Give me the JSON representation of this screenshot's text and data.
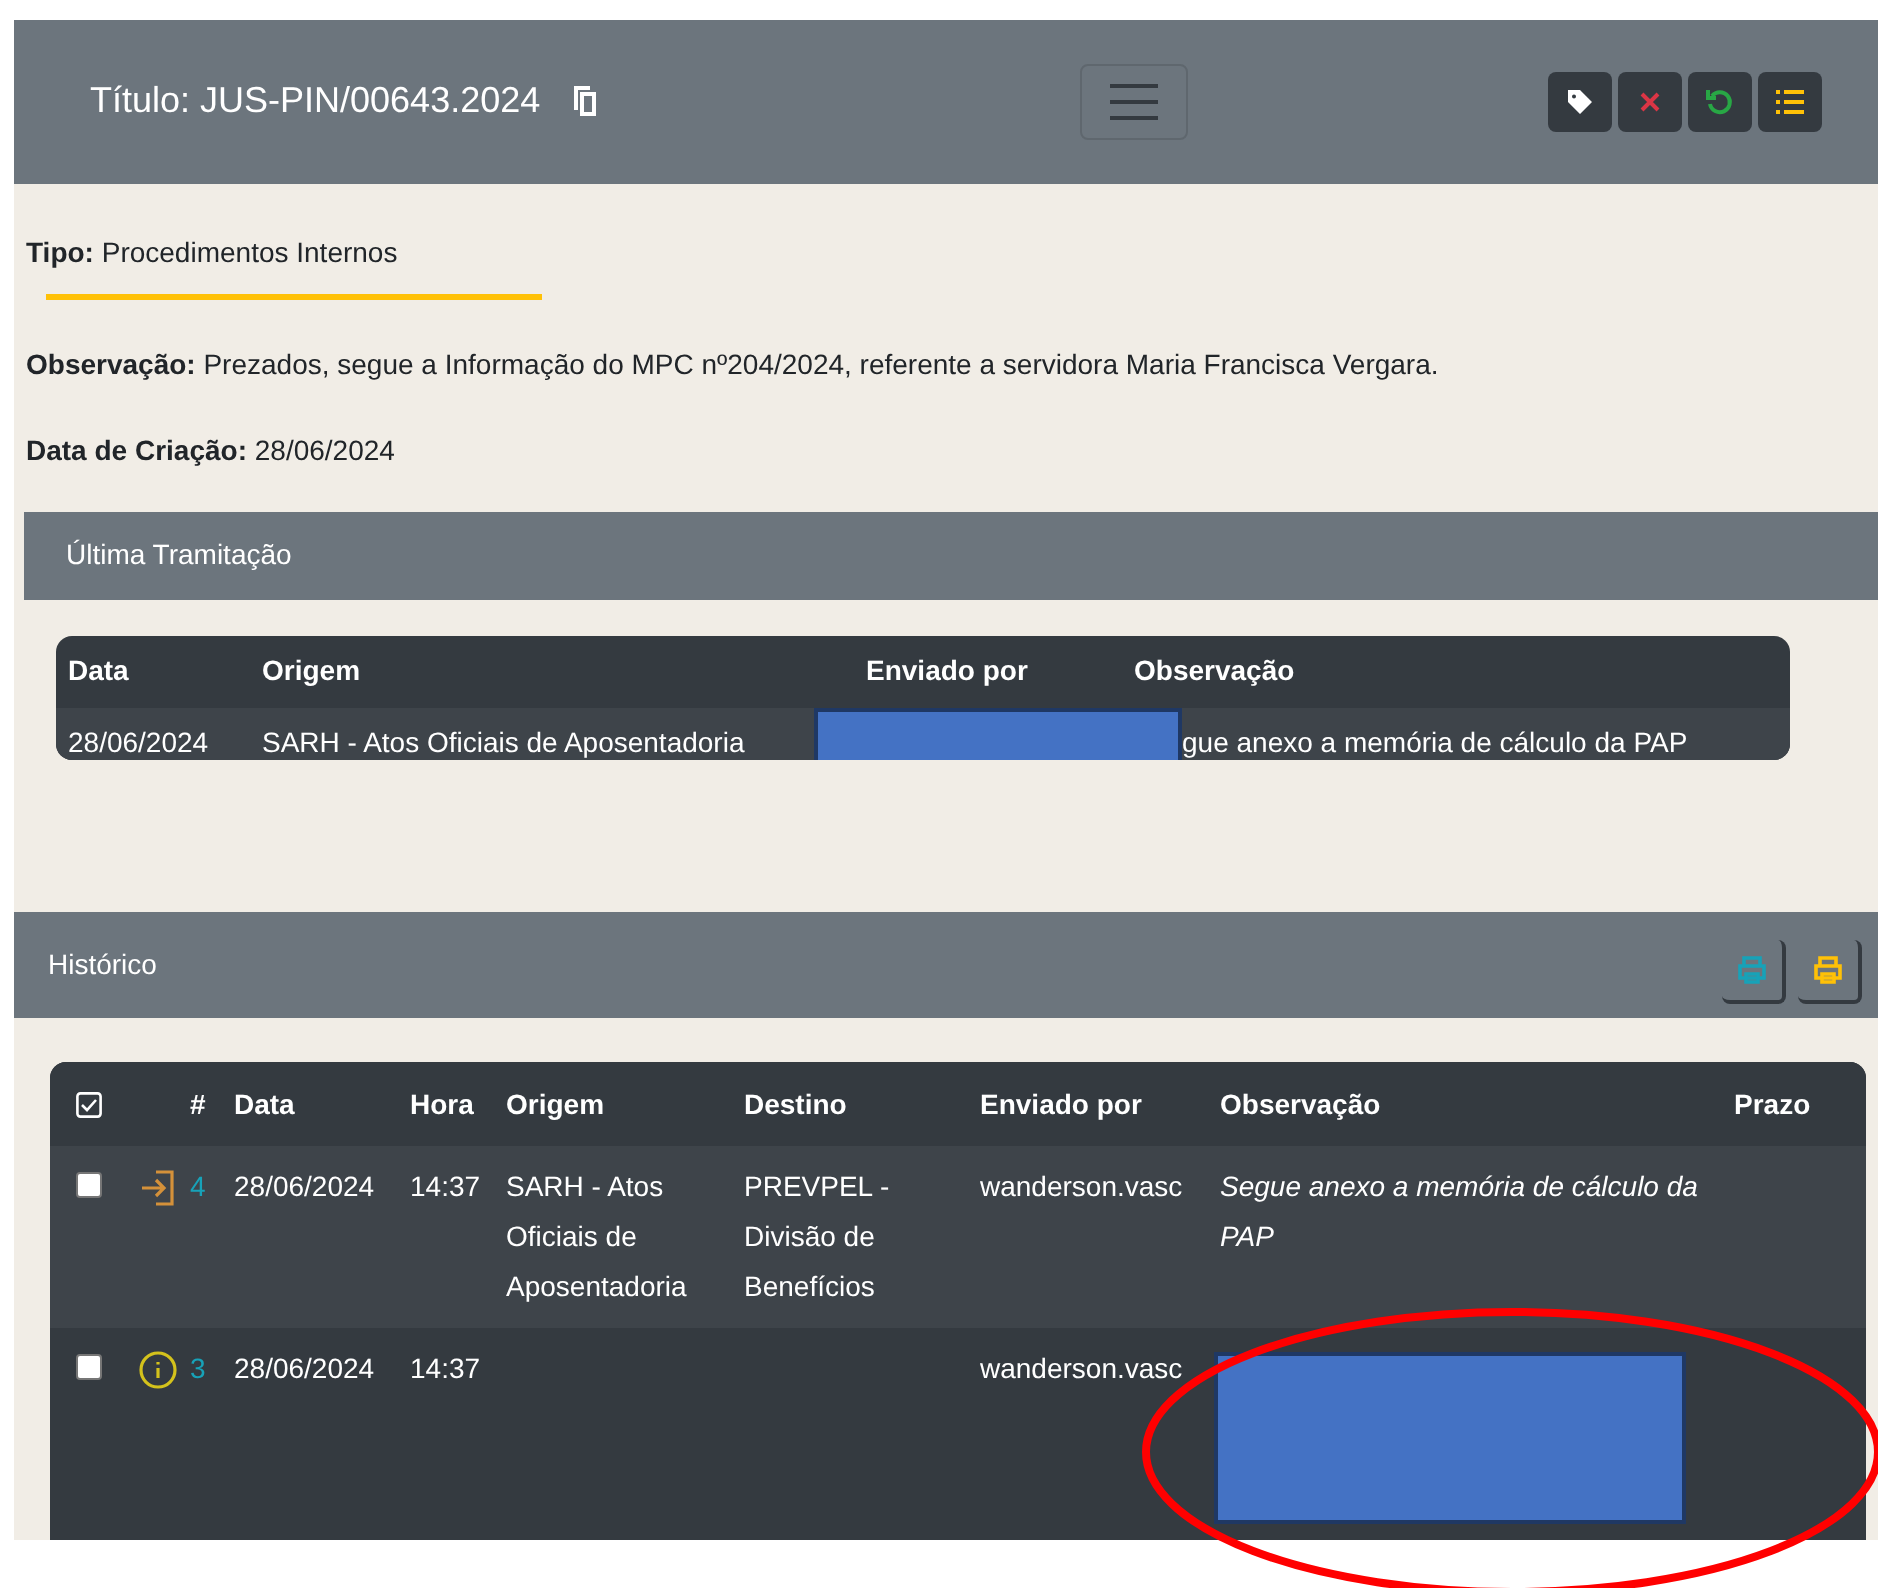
{
  "header": {
    "title": "Título: JUS-PIN/00643.2024"
  },
  "details": [
    {
      "label": "Tipo:",
      "value": "Procedimentos Internos",
      "underline": true
    },
    {
      "label": "Observação:",
      "value": "Prezados, segue a Informação do MPC nº204/2024, referente a servidora Maria Francisca Vergara.",
      "underline": false
    },
    {
      "label": "Data de Criação:",
      "value": "28/06/2024",
      "underline": false
    }
  ],
  "last_transfer": {
    "title": "Última Tramitação",
    "columns": [
      "Data",
      "Origem",
      "Enviado por",
      "Observação"
    ],
    "rows": [
      {
        "date": "28/06/2024",
        "origin": "SARH - Atos Oficiais de Aposentadoria",
        "sender_redacted": true,
        "note": "gue anexo a memória de cálculo da PAP"
      }
    ]
  },
  "history": {
    "title": "Histórico",
    "columns": [
      "#",
      "Data",
      "Hora",
      "Origem",
      "Destino",
      "Enviado por",
      "Observação",
      "Prazo"
    ],
    "rows": [
      {
        "checked": false,
        "kind": "sent",
        "number": "4",
        "date": "28/06/2024",
        "time": "14:37",
        "origin": "SARH - Atos Oficiais de Aposentadoria",
        "destination": "PREVPEL - Divisão de Benefícios",
        "sender": "wanderson.vasc",
        "note": "Segue anexo a memória de cálculo da PAP",
        "note_redacted": false
      },
      {
        "checked": false,
        "kind": "info",
        "number": "3",
        "date": "28/06/2024",
        "time": "14:37",
        "origin": "",
        "destination": "",
        "sender": "wanderson.vasc",
        "note": "",
        "note_redacted": true
      }
    ]
  }
}
